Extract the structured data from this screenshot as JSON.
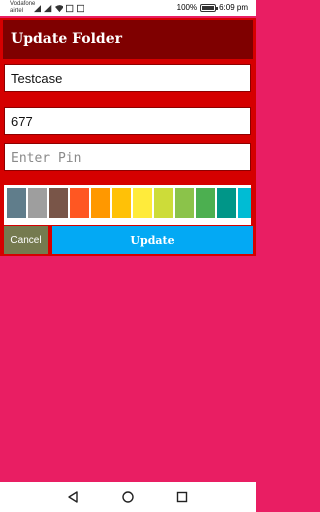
{
  "status_bar": {
    "carrier_1": "Vodafone",
    "carrier_2": "airtel",
    "battery_percent": "100%",
    "time": "6:09 pm"
  },
  "dialog": {
    "title": "Update Folder",
    "folder_name_value": "Testcase",
    "number_value": "677",
    "pin_placeholder": "Enter Pin",
    "cancel_label": "Cancel",
    "update_label": "Update"
  },
  "colors": {
    "background": "#e91e63",
    "dialog_bg": "#d50000",
    "header_bg": "#7f0000",
    "cancel_bg": "#757a4f",
    "update_bg": "#03a9f4"
  },
  "palette": {
    "swatches": [
      "#607d8b",
      "#9e9e9e",
      "#795548",
      "#ff5722",
      "#ff9800",
      "#ffc107",
      "#ffeb3b",
      "#cddc39",
      "#8bc34a",
      "#4caf50",
      "#009688",
      "#00bcd4"
    ]
  },
  "nav_bar": {
    "back_icon": "back-triangle-icon",
    "home_icon": "home-circle-icon",
    "recents_icon": "recents-square-icon"
  }
}
